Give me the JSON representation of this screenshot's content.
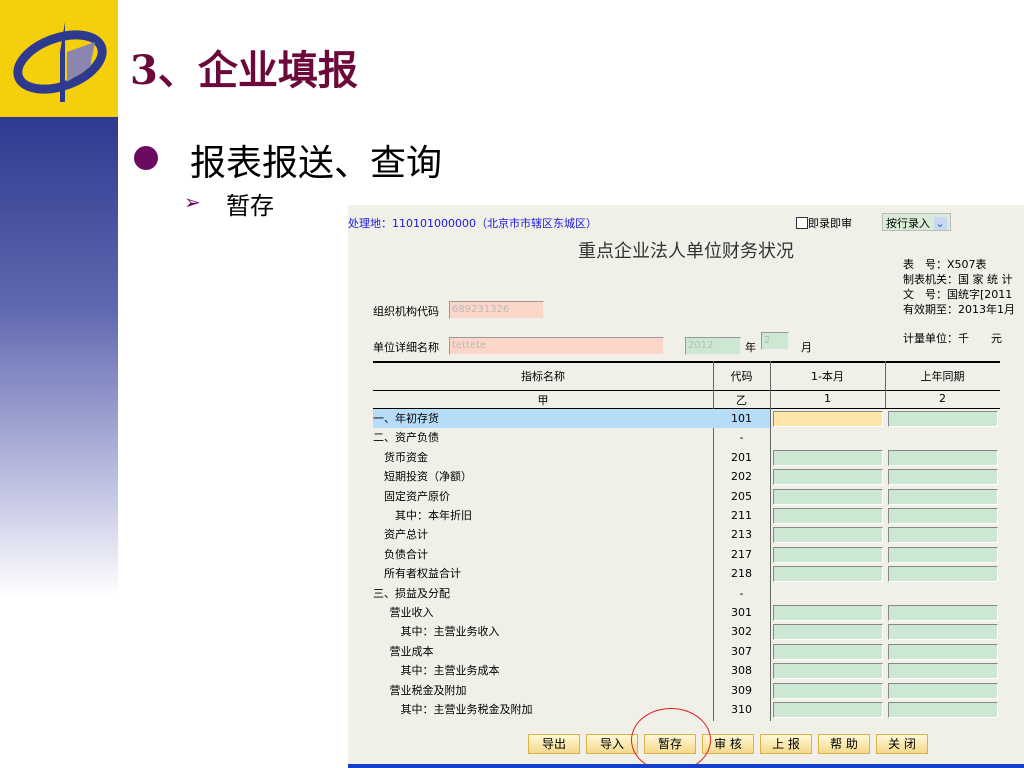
{
  "slide": {
    "title": "3、企业填报",
    "bullet": "报表报送、查询",
    "sub_bullet": "暂存"
  },
  "app": {
    "location": "处理地：110101000000（北京市市辖区东城区）",
    "instant_review_label": "即录即审",
    "entry_mode": "按行录入",
    "form_title": "重点企业法人单位财务状况",
    "meta": [
      "表　号：X507表",
      "制表机关：国 家 统 计",
      "文　号：国统字[2011",
      "有效期至：2013年1月"
    ],
    "unit": "计量单位：千　　元",
    "org_code_label": "组织机构代码",
    "org_code": "689231326",
    "unit_name_label": "单位详细名称",
    "unit_name": "tettete",
    "year": "2012",
    "year_label": "年",
    "month": "2",
    "month_label": "月",
    "headers": [
      "指标名称",
      "代码",
      "1-本月",
      "上年同期"
    ],
    "subheaders": [
      "甲",
      "乙",
      "1",
      "2"
    ],
    "rows": [
      {
        "name": "一、年初存货",
        "code": "101",
        "inputs": true,
        "indent": 0
      },
      {
        "name": "二、资产负债",
        "code": "-",
        "inputs": false,
        "indent": 0
      },
      {
        "name": "货币资金",
        "code": "201",
        "inputs": true,
        "indent": 1
      },
      {
        "name": "短期投资（净额）",
        "code": "202",
        "inputs": true,
        "indent": 1
      },
      {
        "name": "固定资产原价",
        "code": "205",
        "inputs": true,
        "indent": 1
      },
      {
        "name": "其中：本年折旧",
        "code": "211",
        "inputs": true,
        "indent": 2
      },
      {
        "name": "资产总计",
        "code": "213",
        "inputs": true,
        "indent": 1
      },
      {
        "name": "负债合计",
        "code": "217",
        "inputs": true,
        "indent": 1
      },
      {
        "name": "所有者权益合计",
        "code": "218",
        "inputs": true,
        "indent": 1
      },
      {
        "name": "三、损益及分配",
        "code": "-",
        "inputs": false,
        "indent": 0
      },
      {
        "name": "营业收入",
        "code": "301",
        "inputs": true,
        "indent": 1.5
      },
      {
        "name": "其中：主营业务收入",
        "code": "302",
        "inputs": true,
        "indent": 2.5
      },
      {
        "name": "营业成本",
        "code": "307",
        "inputs": true,
        "indent": 1.5
      },
      {
        "name": "其中：主营业务成本",
        "code": "308",
        "inputs": true,
        "indent": 2.5
      },
      {
        "name": "营业税金及附加",
        "code": "309",
        "inputs": true,
        "indent": 1.5
      },
      {
        "name": "其中：主营业务税金及附加",
        "code": "310",
        "inputs": true,
        "indent": 2.5
      }
    ],
    "buttons": [
      "导出",
      "导入",
      "暂存",
      "审 核",
      "上 报",
      "帮 助",
      "关 闭"
    ]
  }
}
